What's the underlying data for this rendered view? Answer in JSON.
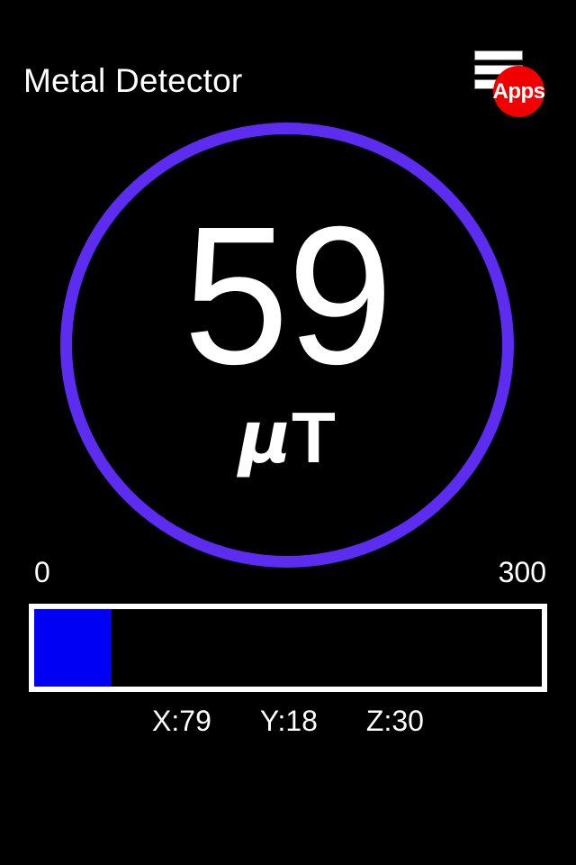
{
  "header": {
    "title": "Metal Detector",
    "apps_button": {
      "label": "Apps",
      "menu_icon": "hamburger-icon",
      "badge_color": "#f20000"
    }
  },
  "gauge": {
    "value": "59",
    "unit_mu": "μ",
    "unit_suffix": "T",
    "unit_full": "μT",
    "ring_color": "#5c2cf0",
    "background_color": "#000000"
  },
  "scale": {
    "min_label": "0",
    "max_label": "300",
    "min_value": 0,
    "max_value": 300
  },
  "level_bar": {
    "fill_percent": 15.3,
    "fill_color": "#0000f5",
    "border_color": "#ffffff",
    "track_color": "#000000"
  },
  "axis_readouts": {
    "x": "X:79",
    "y": "Y:18",
    "z": "Z:30"
  }
}
